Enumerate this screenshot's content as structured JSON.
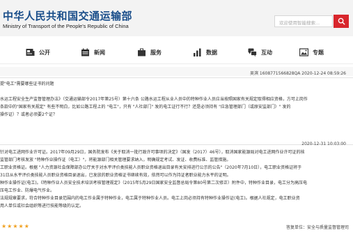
{
  "header": {
    "title": "中华人民共和国交通运输部",
    "subtitle": "Ministry of Transport of the People's Republic of China",
    "search_placeholder": "欢迎使用智能搜索..."
  },
  "nav": {
    "items": [
      {
        "label": "公开",
        "icon": "newspaper-icon"
      },
      {
        "label": "新闻",
        "icon": "calendar-icon"
      },
      {
        "label": "服务",
        "icon": "briefcase-icon"
      },
      {
        "label": "数据",
        "icon": "bar-chart-icon"
      },
      {
        "label": "互动",
        "icon": "chat-icon"
      },
      {
        "label": "专题",
        "icon": "image-icon"
      }
    ]
  },
  "question": {
    "meta": "吴滨 1608771566828QA  2020-12-24 08:59:26",
    "lines": [
      "提\"电工\"需要哪些证书的问题",
      "",
      "水运工程安全生产监督管理办法》（交通运输部令2017年第25号）第十六条 公路水运工程从业人员中的特种作业人员应当按照国家有关规定取得相应资格，方可上岗作",
      "条款中的\"国家有关规定\" 有些不明白，比如公路工程上的 \"电工\"，只有 \"人社部门\" 发的电工证行不行？还是必须持有 \"应急管理部门（或原安监部门）\" 发的",
      "操作证）？或者必须要2个证？"
    ]
  },
  "answer": {
    "meta": "2020-12-31 10:03:00",
    "lines": [
      "针对电工进网作业许可证。2017年09月29日，国务院发布《关于取消一批行政许可事项的决定》（国发（2017）46号），取消国家能源局对电工进网作业许可证的核",
      "监管部门考核发放 \"特种作业操作证（电工）\"，将能源部门相关管理要求纳入，明确规定考试、发证、收费标准、监管措施。",
      "工职业资格证。根据 \"人力资源社会保障部办公厅关于对水平评价类技能人员职业资格退出目录有关安排进行公示的公告\"（2020年7月10日），电工职业资格证将于",
      "31日从水平评价类技能人员职业资格目录退出，已发放的职业资格证书继续有效，依然可以作为持证者职业能力水平的证明。",
      "种作业操作证(电工)。《特种作业人员安全技术培训考核管理规定》（2015年5月29日国家安全监督总局令第80号第二次修正）附件中，特种作业目录，电工分为高压电",
      "压电工作业、防爆电气作业。",
      "法规规章要求，符合特种作业目录范围内的电工作业属于特种作业，电工属于特种作业人员。电工上岗必须持有特种作业操作证(电工)。根据人社规定，电工职业资",
      "用人单位或社会组织等进行技能等级的认定。"
    ]
  },
  "footer": {
    "stars": "★★★★★",
    "department": "答复单位：安全与质量监督管理司"
  },
  "colors": {
    "brand_blue": "#1a4e8a",
    "search_red": "#d8262c",
    "star": "#f0a020"
  }
}
